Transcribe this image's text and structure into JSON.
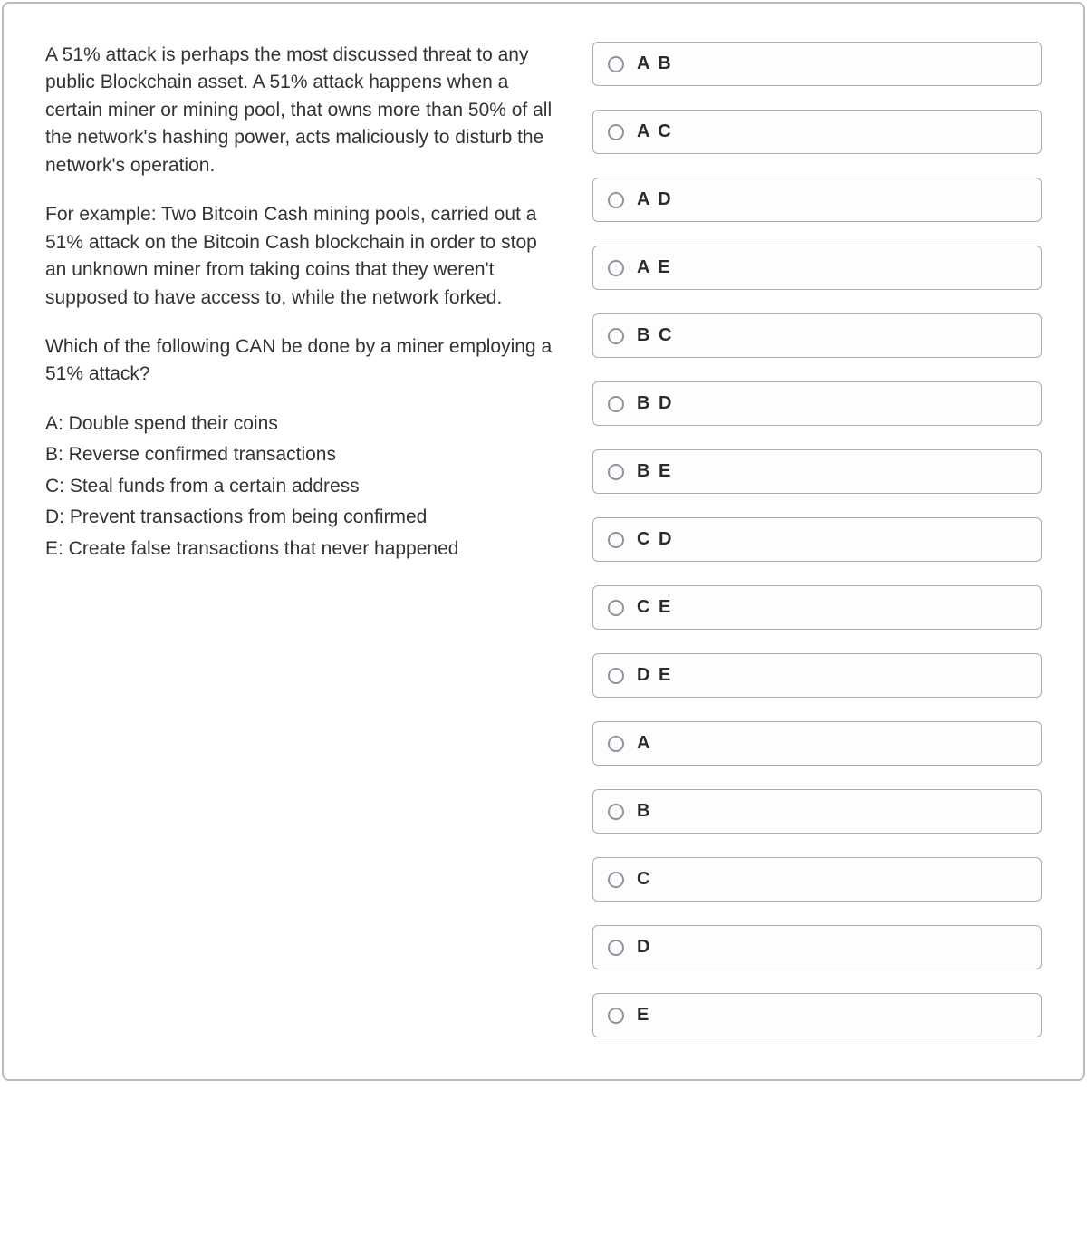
{
  "question": {
    "paragraphs": [
      "A 51% attack is perhaps the most discussed threat to any public Blockchain asset. A 51% attack happens when a certain miner or mining pool, that owns more than 50% of all the network's hashing power, acts maliciously to disturb the network's operation.",
      "For example: Two Bitcoin Cash mining pools, carried out a 51% attack on the Bitcoin Cash blockchain in order to stop an unknown miner from taking coins that they weren't supposed to have access to, while the network forked.",
      "Which of the following CAN be done by a miner employing a 51% attack?"
    ],
    "options": [
      "A: Double spend their coins",
      "B: Reverse confirmed transactions",
      "C: Steal funds from a certain address",
      "D: Prevent transactions from being confirmed",
      "E: Create false transactions that never happened"
    ]
  },
  "answers": [
    {
      "label": "A B"
    },
    {
      "label": "A C"
    },
    {
      "label": "A D"
    },
    {
      "label": "A E"
    },
    {
      "label": "B C"
    },
    {
      "label": "B D"
    },
    {
      "label": "B E"
    },
    {
      "label": "C D"
    },
    {
      "label": "C E"
    },
    {
      "label": "D E"
    },
    {
      "label": "A"
    },
    {
      "label": "B"
    },
    {
      "label": "C"
    },
    {
      "label": "D"
    },
    {
      "label": "E"
    }
  ]
}
